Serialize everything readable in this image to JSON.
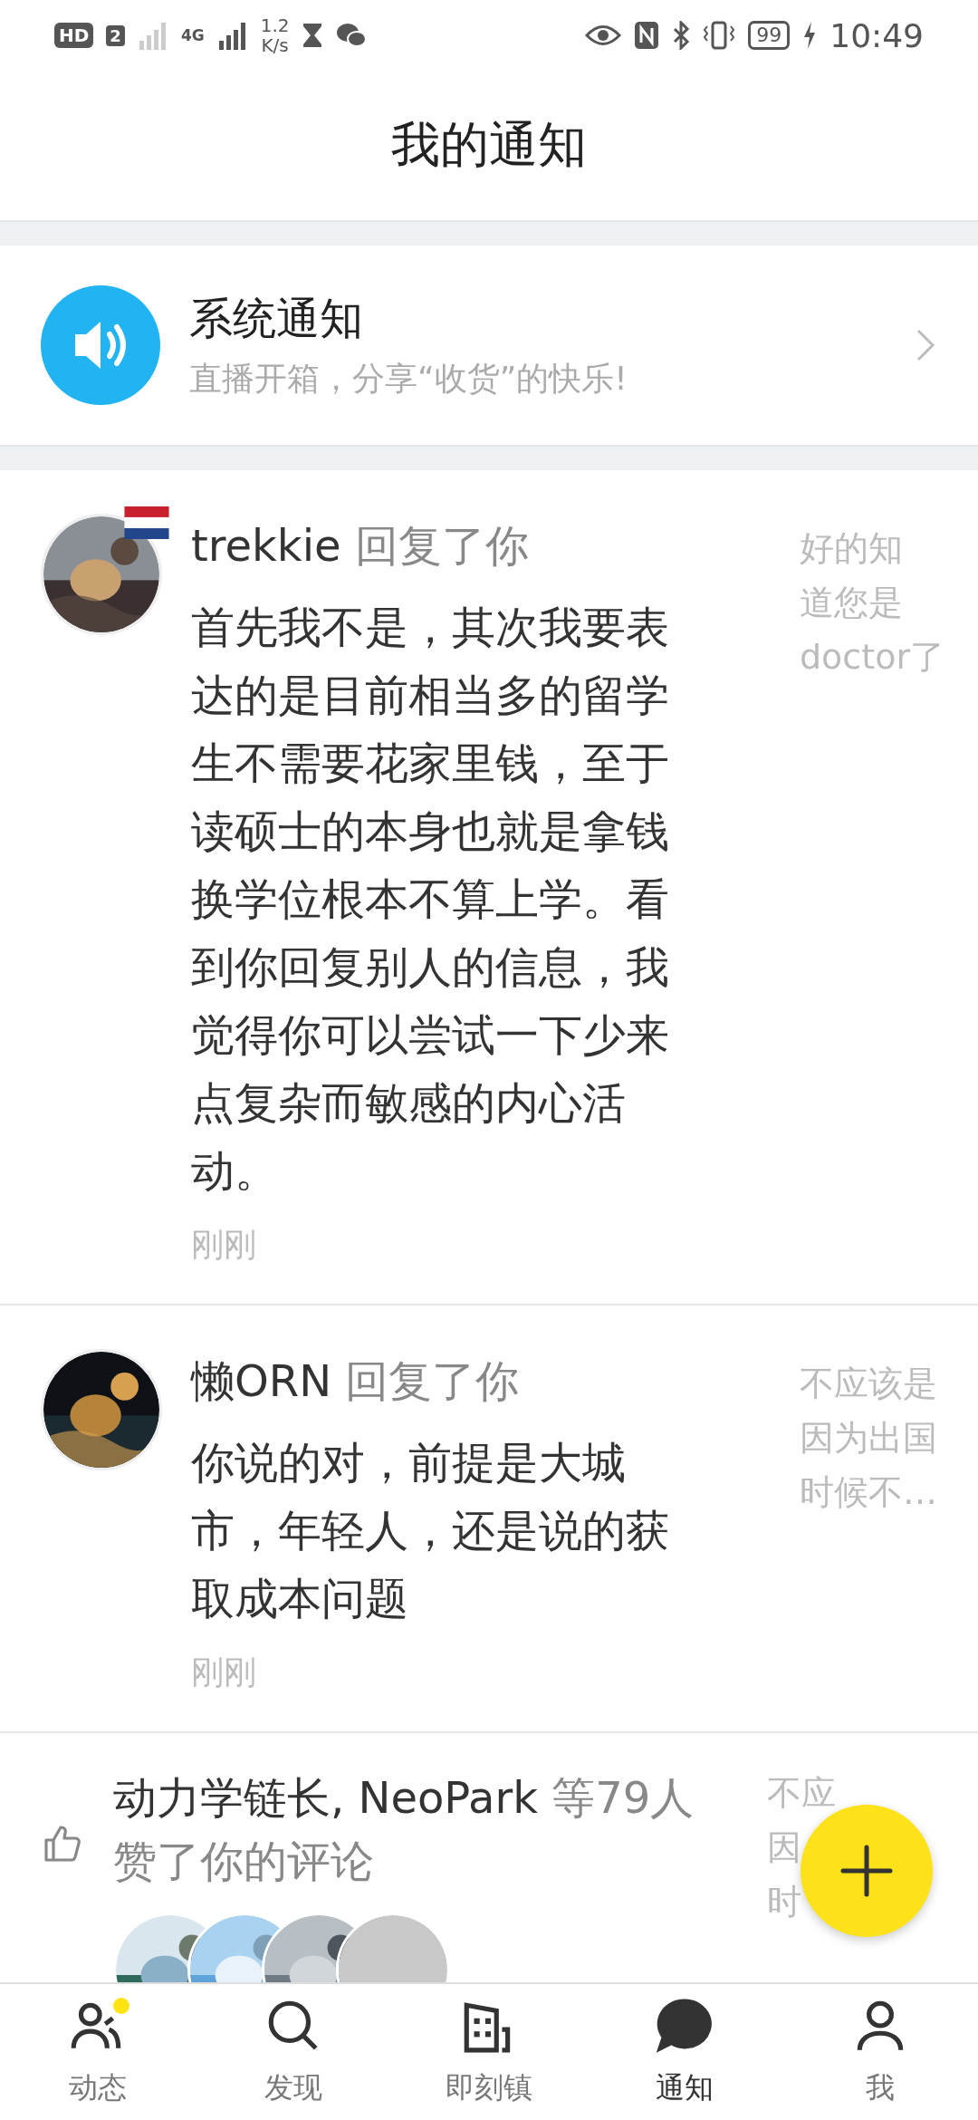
{
  "status_bar": {
    "hd_label": "HD",
    "sim_label": "2",
    "network_label": "4G",
    "speed_value": "1.2",
    "speed_unit": "K/s",
    "battery": "99",
    "time": "10:49"
  },
  "header": {
    "title": "我的通知"
  },
  "system_notice": {
    "title": "系统通知",
    "subtitle": "直播开箱，分享“收货”的快乐!"
  },
  "notifications": [
    {
      "kind": "reply",
      "user": "trekkie",
      "action": "回复了你",
      "flag": true,
      "body": "首先我不是，其次我要表达的是目前相当多的留学生不需要花家里钱，至于读硕士的本身也就是拿钱换学位根本不算上学。看到你回复别人的信息，我觉得你可以尝试一下少来点复杂而敏感的内心活动。",
      "time": "刚刚",
      "snippet": [
        "好的知",
        "道您是",
        "doctor了"
      ]
    },
    {
      "kind": "reply",
      "user": "懒ORN",
      "action": "回复了你",
      "flag": false,
      "body": "你说的对，前提是大城市，年轻人，还是说的获取成本问题",
      "time": "刚刚",
      "snippet": [
        "不应该是",
        "因为出国",
        "时候不…"
      ]
    },
    {
      "kind": "like",
      "user": "动力学链长, NeoPark",
      "count": "等79人",
      "action": "赞了你的评论",
      "snippet": [
        "不应",
        "因",
        "时"
      ]
    }
  ],
  "bottom_nav": [
    {
      "kind": "people",
      "label": "动态",
      "selected": false,
      "dot": true
    },
    {
      "kind": "search",
      "label": "发现",
      "selected": false,
      "dot": false
    },
    {
      "kind": "building",
      "label": "即刻镇",
      "selected": false,
      "dot": false
    },
    {
      "kind": "chat",
      "label": "通知",
      "selected": true,
      "dot": false
    },
    {
      "kind": "person",
      "label": "我",
      "selected": false,
      "dot": false
    }
  ]
}
